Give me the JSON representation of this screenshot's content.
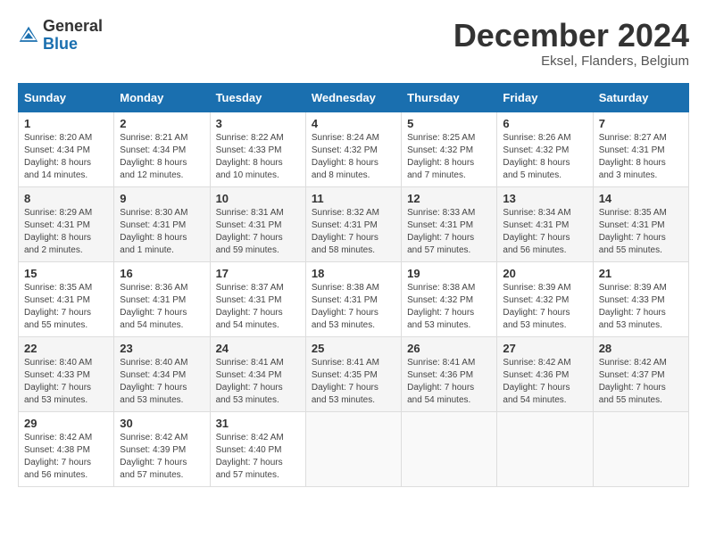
{
  "header": {
    "logo_general": "General",
    "logo_blue": "Blue",
    "month_title": "December 2024",
    "location": "Eksel, Flanders, Belgium"
  },
  "calendar": {
    "days_of_week": [
      "Sunday",
      "Monday",
      "Tuesday",
      "Wednesday",
      "Thursday",
      "Friday",
      "Saturday"
    ],
    "weeks": [
      [
        {
          "day": "",
          "info": ""
        },
        {
          "day": "2",
          "info": "Sunrise: 8:21 AM\nSunset: 4:34 PM\nDaylight: 8 hours\nand 12 minutes."
        },
        {
          "day": "3",
          "info": "Sunrise: 8:22 AM\nSunset: 4:33 PM\nDaylight: 8 hours\nand 10 minutes."
        },
        {
          "day": "4",
          "info": "Sunrise: 8:24 AM\nSunset: 4:32 PM\nDaylight: 8 hours\nand 8 minutes."
        },
        {
          "day": "5",
          "info": "Sunrise: 8:25 AM\nSunset: 4:32 PM\nDaylight: 8 hours\nand 7 minutes."
        },
        {
          "day": "6",
          "info": "Sunrise: 8:26 AM\nSunset: 4:32 PM\nDaylight: 8 hours\nand 5 minutes."
        },
        {
          "day": "7",
          "info": "Sunrise: 8:27 AM\nSunset: 4:31 PM\nDaylight: 8 hours\nand 3 minutes."
        }
      ],
      [
        {
          "day": "8",
          "info": "Sunrise: 8:29 AM\nSunset: 4:31 PM\nDaylight: 8 hours\nand 2 minutes."
        },
        {
          "day": "9",
          "info": "Sunrise: 8:30 AM\nSunset: 4:31 PM\nDaylight: 8 hours\nand 1 minute."
        },
        {
          "day": "10",
          "info": "Sunrise: 8:31 AM\nSunset: 4:31 PM\nDaylight: 7 hours\nand 59 minutes."
        },
        {
          "day": "11",
          "info": "Sunrise: 8:32 AM\nSunset: 4:31 PM\nDaylight: 7 hours\nand 58 minutes."
        },
        {
          "day": "12",
          "info": "Sunrise: 8:33 AM\nSunset: 4:31 PM\nDaylight: 7 hours\nand 57 minutes."
        },
        {
          "day": "13",
          "info": "Sunrise: 8:34 AM\nSunset: 4:31 PM\nDaylight: 7 hours\nand 56 minutes."
        },
        {
          "day": "14",
          "info": "Sunrise: 8:35 AM\nSunset: 4:31 PM\nDaylight: 7 hours\nand 55 minutes."
        }
      ],
      [
        {
          "day": "15",
          "info": "Sunrise: 8:35 AM\nSunset: 4:31 PM\nDaylight: 7 hours\nand 55 minutes."
        },
        {
          "day": "16",
          "info": "Sunrise: 8:36 AM\nSunset: 4:31 PM\nDaylight: 7 hours\nand 54 minutes."
        },
        {
          "day": "17",
          "info": "Sunrise: 8:37 AM\nSunset: 4:31 PM\nDaylight: 7 hours\nand 54 minutes."
        },
        {
          "day": "18",
          "info": "Sunrise: 8:38 AM\nSunset: 4:31 PM\nDaylight: 7 hours\nand 53 minutes."
        },
        {
          "day": "19",
          "info": "Sunrise: 8:38 AM\nSunset: 4:32 PM\nDaylight: 7 hours\nand 53 minutes."
        },
        {
          "day": "20",
          "info": "Sunrise: 8:39 AM\nSunset: 4:32 PM\nDaylight: 7 hours\nand 53 minutes."
        },
        {
          "day": "21",
          "info": "Sunrise: 8:39 AM\nSunset: 4:33 PM\nDaylight: 7 hours\nand 53 minutes."
        }
      ],
      [
        {
          "day": "22",
          "info": "Sunrise: 8:40 AM\nSunset: 4:33 PM\nDaylight: 7 hours\nand 53 minutes."
        },
        {
          "day": "23",
          "info": "Sunrise: 8:40 AM\nSunset: 4:34 PM\nDaylight: 7 hours\nand 53 minutes."
        },
        {
          "day": "24",
          "info": "Sunrise: 8:41 AM\nSunset: 4:34 PM\nDaylight: 7 hours\nand 53 minutes."
        },
        {
          "day": "25",
          "info": "Sunrise: 8:41 AM\nSunset: 4:35 PM\nDaylight: 7 hours\nand 53 minutes."
        },
        {
          "day": "26",
          "info": "Sunrise: 8:41 AM\nSunset: 4:36 PM\nDaylight: 7 hours\nand 54 minutes."
        },
        {
          "day": "27",
          "info": "Sunrise: 8:42 AM\nSunset: 4:36 PM\nDaylight: 7 hours\nand 54 minutes."
        },
        {
          "day": "28",
          "info": "Sunrise: 8:42 AM\nSunset: 4:37 PM\nDaylight: 7 hours\nand 55 minutes."
        }
      ],
      [
        {
          "day": "29",
          "info": "Sunrise: 8:42 AM\nSunset: 4:38 PM\nDaylight: 7 hours\nand 56 minutes."
        },
        {
          "day": "30",
          "info": "Sunrise: 8:42 AM\nSunset: 4:39 PM\nDaylight: 7 hours\nand 57 minutes."
        },
        {
          "day": "31",
          "info": "Sunrise: 8:42 AM\nSunset: 4:40 PM\nDaylight: 7 hours\nand 57 minutes."
        },
        {
          "day": "",
          "info": ""
        },
        {
          "day": "",
          "info": ""
        },
        {
          "day": "",
          "info": ""
        },
        {
          "day": "",
          "info": ""
        }
      ]
    ],
    "week1_day1": {
      "day": "1",
      "info": "Sunrise: 8:20 AM\nSunset: 4:34 PM\nDaylight: 8 hours\nand 14 minutes."
    }
  }
}
